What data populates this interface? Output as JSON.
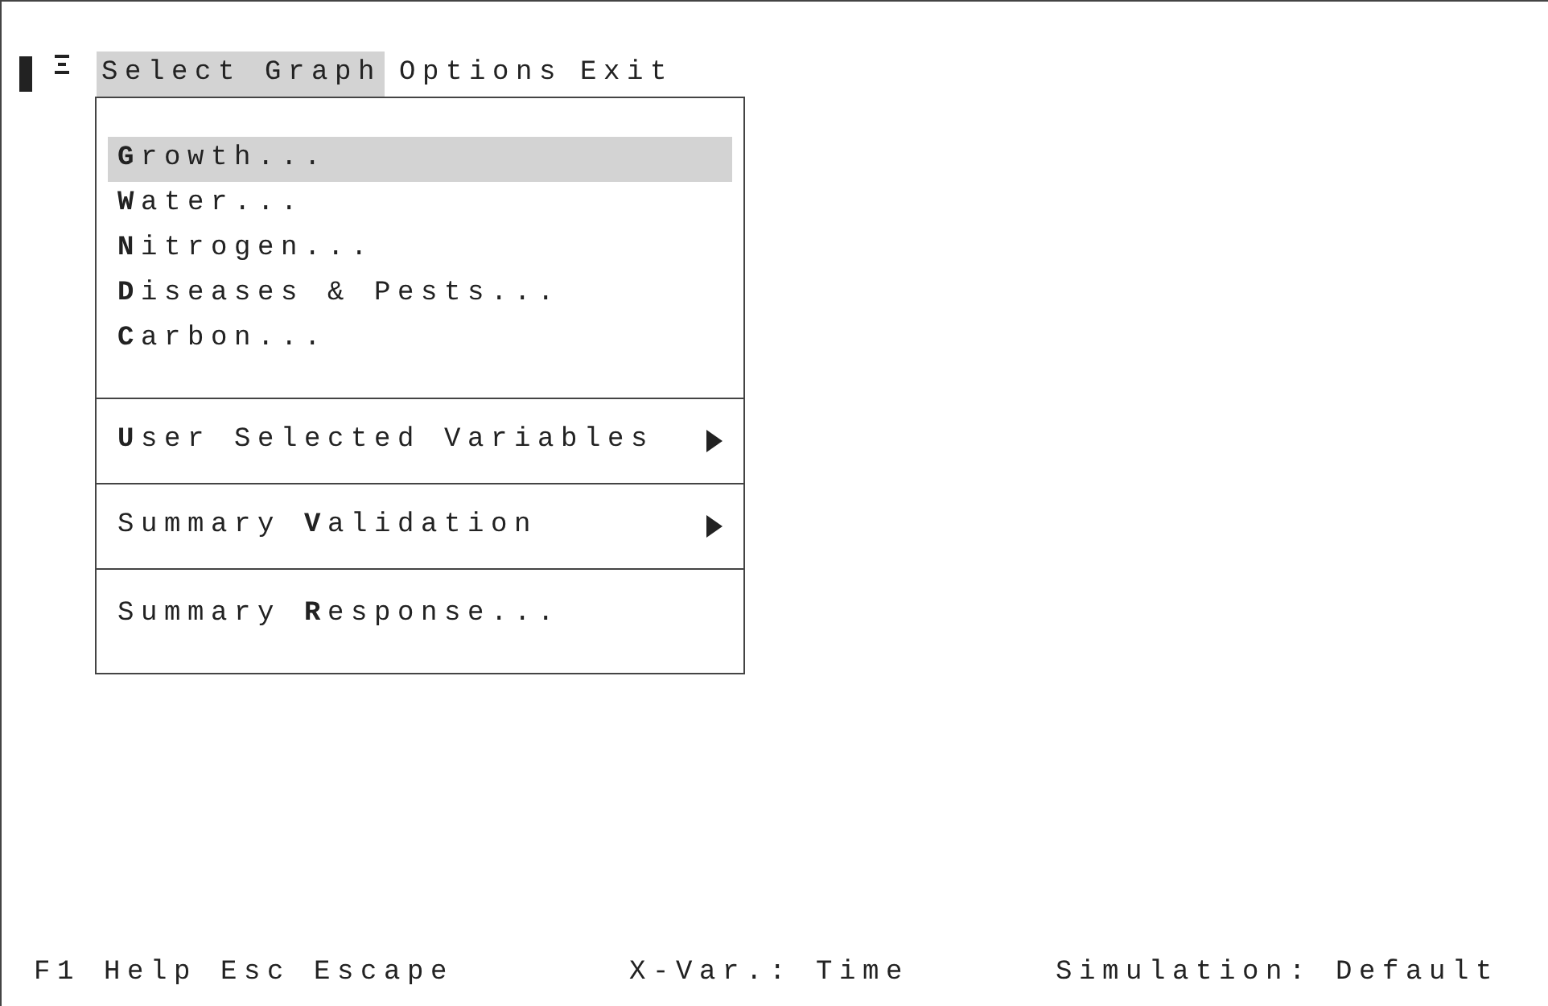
{
  "menu_bar": [
    {
      "label": "Select Graph",
      "selected": true
    },
    {
      "label": "Options",
      "selected": false
    },
    {
      "label": "Exit",
      "selected": false
    }
  ],
  "dropdown": {
    "groups": [
      {
        "items": [
          {
            "label": "**G**rowth...",
            "selected": true,
            "submenu": false
          },
          {
            "label": "**W**ater...",
            "selected": false,
            "submenu": false
          },
          {
            "label": "**N**itrogen...",
            "selected": false,
            "submenu": false
          },
          {
            "label": "**D**iseases & Pests...",
            "selected": false,
            "submenu": false
          },
          {
            "label": "**C**arbon...",
            "selected": false,
            "submenu": false
          }
        ]
      },
      {
        "items": [
          {
            "label": "**U**ser Selected Variables",
            "selected": false,
            "submenu": true
          }
        ]
      },
      {
        "items": [
          {
            "label": "Summary **V**alidation",
            "selected": false,
            "submenu": true
          }
        ]
      },
      {
        "items": [
          {
            "label": "Summary **R**esponse...",
            "selected": false,
            "submenu": false
          }
        ]
      }
    ]
  },
  "status_bar": [
    "F1 Help",
    "Esc Escape",
    "X-Var.: Time",
    "Simulation: Default"
  ]
}
